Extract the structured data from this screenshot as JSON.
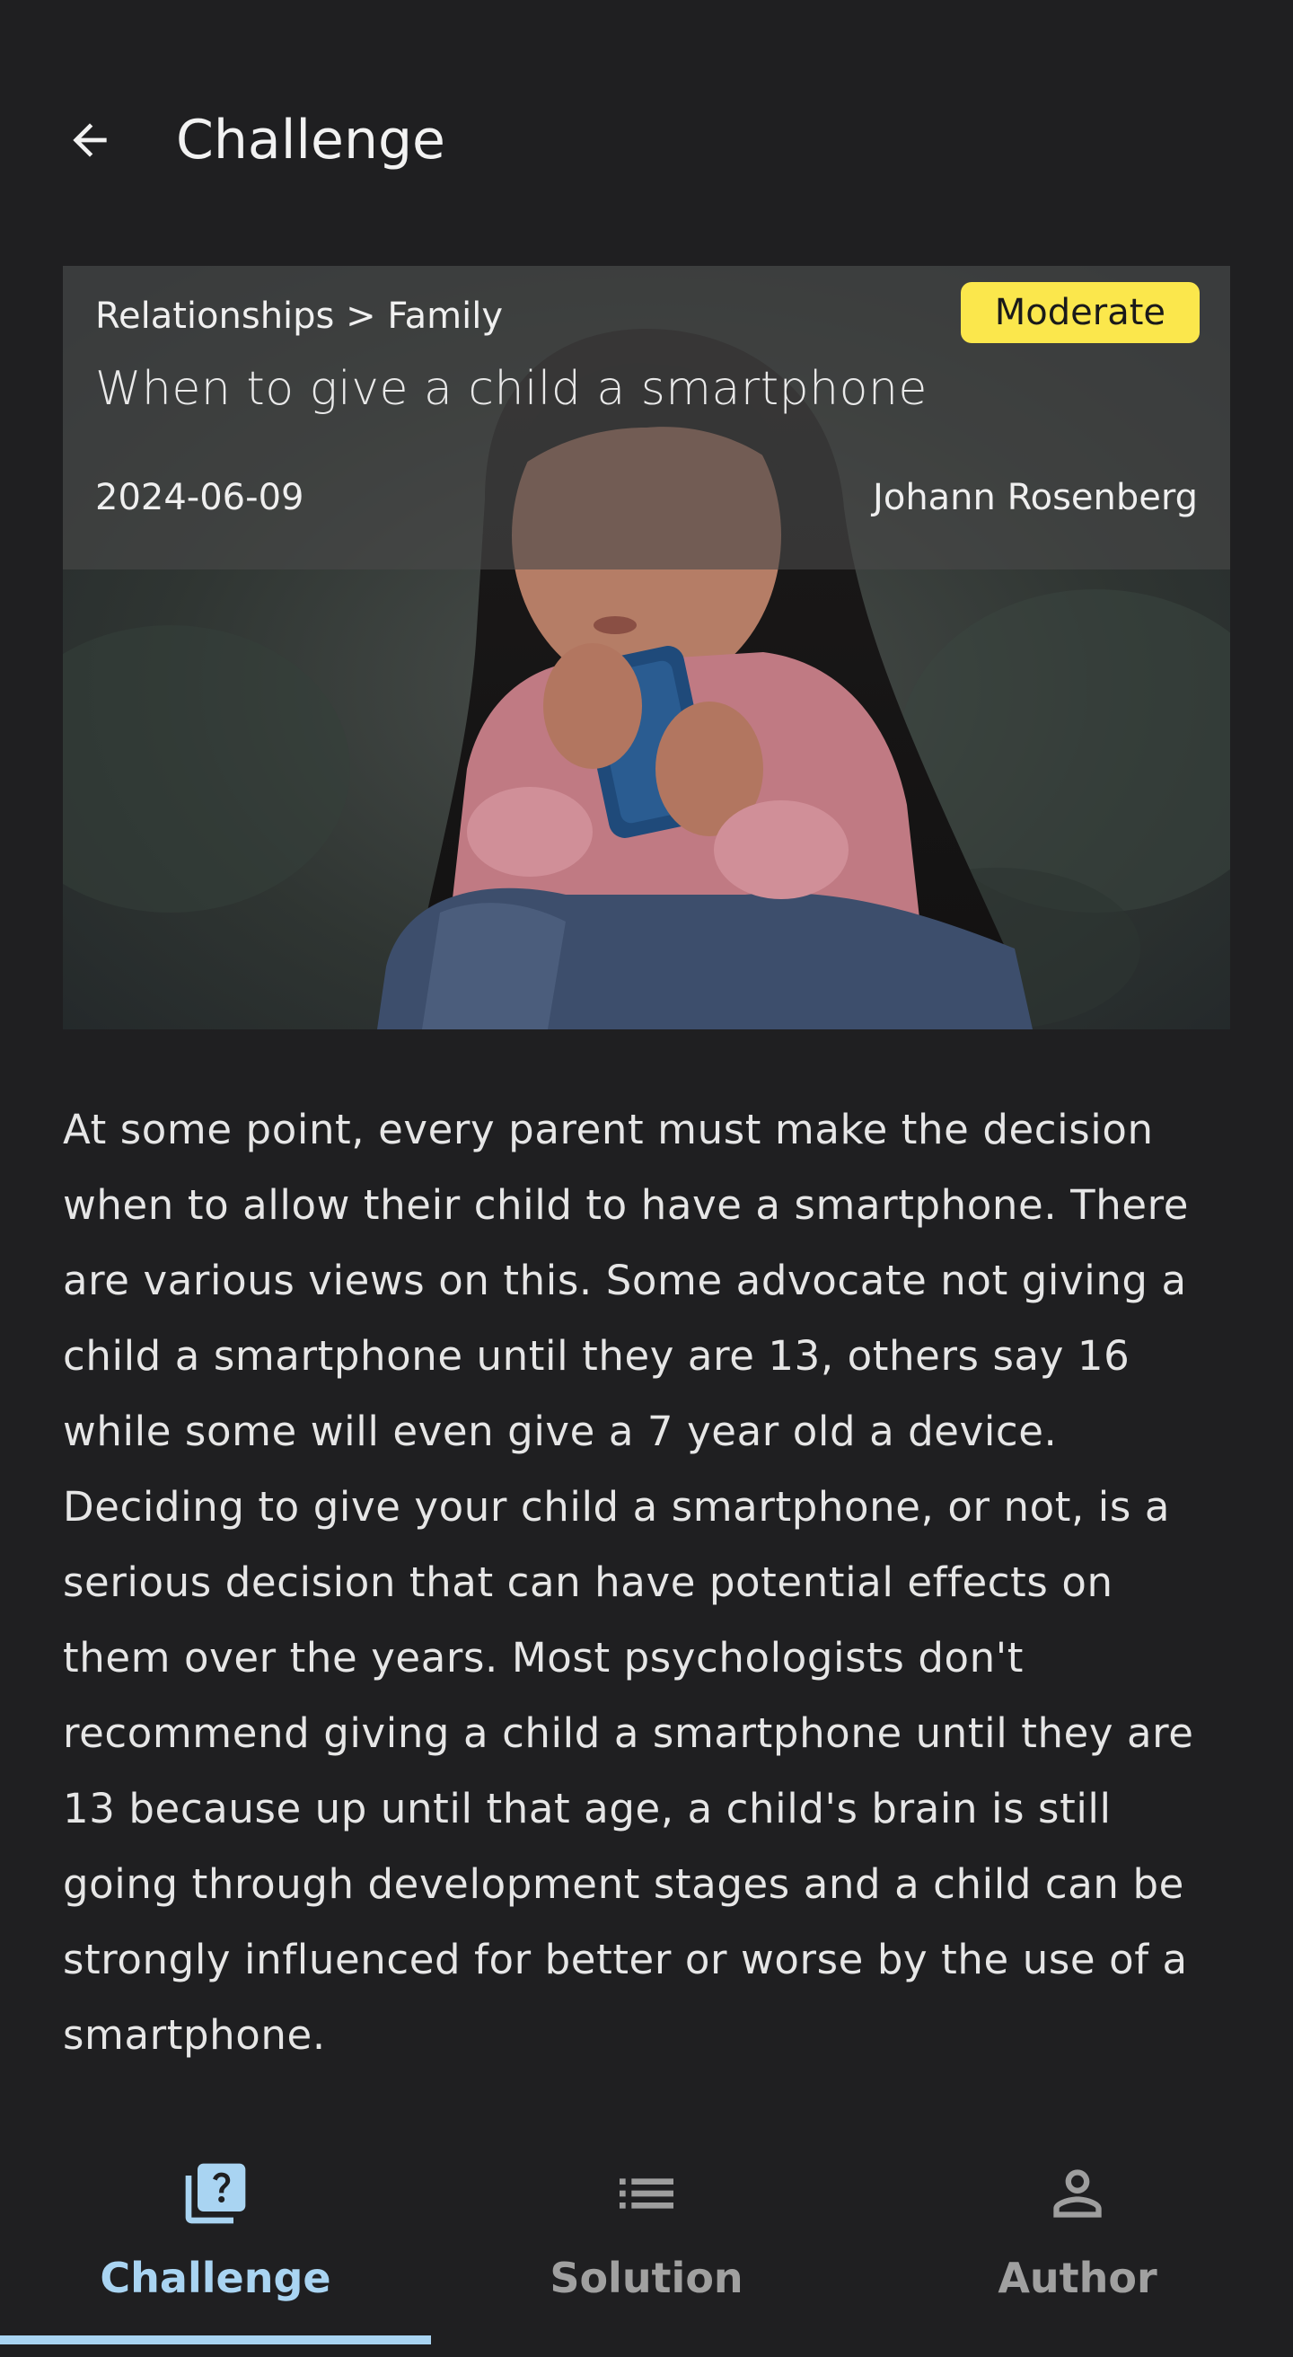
{
  "header": {
    "title": "Challenge",
    "back_icon": "arrow-back-icon"
  },
  "challenge": {
    "category": "Relationships > Family",
    "difficulty": "Moderate",
    "title": "When to give a child a smartphone",
    "date": "2024-06-09",
    "author": "Johann Rosenberg",
    "description": "At some point, every parent must make the decision when to allow their child to have a smartphone. There are various views on this. Some advocate not giving a child a smartphone until they are 13, others say 16 while some will even give a 7 year old a device. Deciding to give your child a smartphone, or not, is a serious decision that can have potential effects on them over the years. Most psychologists don't recommend giving a child a smartphone until they are 13 because up until that age, a child's brain is still going through development stages and a child can be strongly influenced for better or worse by the use of a smartphone."
  },
  "bottom_nav": {
    "tabs": [
      {
        "label": "Challenge",
        "icon": "quiz-icon",
        "active": true
      },
      {
        "label": "Solution",
        "icon": "list-icon",
        "active": false
      },
      {
        "label": "Author",
        "icon": "person-icon",
        "active": false
      }
    ]
  },
  "colors": {
    "background": "#1f1f21",
    "badge": "#fbe74c",
    "active_tab": "#a9d4f2",
    "inactive_tab": "#a0a0a0"
  }
}
